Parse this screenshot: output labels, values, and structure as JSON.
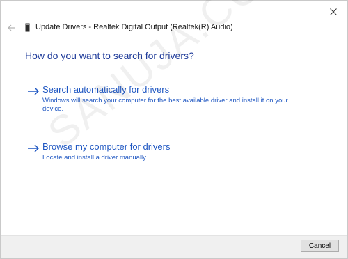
{
  "dialog": {
    "title": "Update Drivers - Realtek Digital Output (Realtek(R) Audio)",
    "heading": "How do you want to search for drivers?"
  },
  "options": [
    {
      "title": "Search automatically for drivers",
      "description": "Windows will search your computer for the best available driver and install it on your device."
    },
    {
      "title": "Browse my computer for drivers",
      "description": "Locate and install a driver manually."
    }
  ],
  "footer": {
    "cancel_label": "Cancel"
  },
  "watermark": "SANUJA.COM",
  "icons": {
    "close": "close-icon",
    "back": "back-arrow-icon",
    "device": "audio-device-icon",
    "option": "arrow-right-icon"
  },
  "colors": {
    "link": "#1f57c2",
    "heading": "#1f3b9a",
    "footer_bg": "#f0f0f0"
  }
}
